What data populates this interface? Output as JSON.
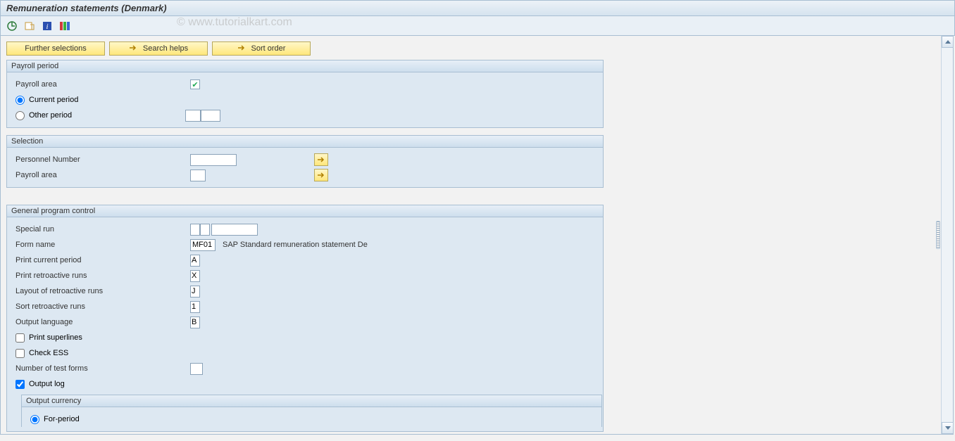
{
  "title": "Remuneration statements (Denmark)",
  "watermark": "© www.tutorialkart.com",
  "toolbar_icons": {
    "execute": "execute-icon",
    "variant": "get-variant-icon",
    "info": "info-icon",
    "program": "program-icon"
  },
  "buttons": {
    "further_selections": "Further selections",
    "search_helps": "Search helps",
    "sort_order": "Sort order"
  },
  "groups": {
    "payroll_period": {
      "title": "Payroll period",
      "payroll_area_label": "Payroll area",
      "current_period_label": "Current period",
      "other_period_label": "Other period",
      "other_period_v1": "",
      "other_period_v2": ""
    },
    "selection": {
      "title": "Selection",
      "personnel_number_label": "Personnel Number",
      "personnel_number_value": "",
      "payroll_area_label": "Payroll area",
      "payroll_area_value": ""
    },
    "general": {
      "title": "General program control",
      "special_run_label": "Special run",
      "special_run_v1": "",
      "special_run_v2": "",
      "form_name_label": "Form name",
      "form_name_value": "MF01",
      "form_name_desc": "SAP Standard remuneration statement De",
      "print_current_label": "Print current period",
      "print_current_value": "A",
      "print_retro_label": "Print retroactive runs",
      "print_retro_value": "X",
      "layout_retro_label": "Layout of retroactive runs",
      "layout_retro_value": "J",
      "sort_retro_label": "Sort retroactive runs",
      "sort_retro_value": "1",
      "output_lang_label": "Output language",
      "output_lang_value": "B",
      "print_superlines_label": "Print superlines",
      "check_ess_label": "Check ESS",
      "num_test_label": "Number of test forms",
      "num_test_value": "",
      "output_log_label": "Output log",
      "output_currency": {
        "title": "Output currency",
        "for_period_label": "For-period"
      }
    }
  }
}
